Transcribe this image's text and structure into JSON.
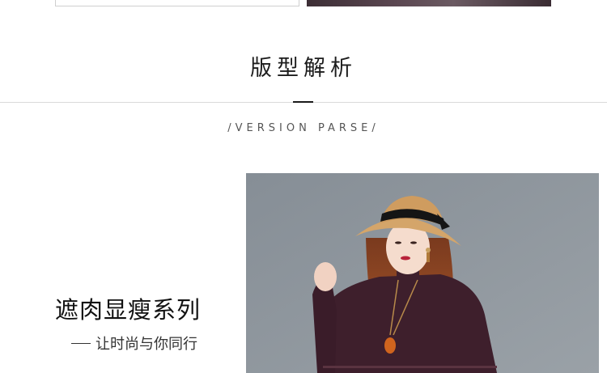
{
  "section": {
    "title": "版型解析",
    "subtitle": "/VERSION PARSE/"
  },
  "series": {
    "title": "遮肉显瘦系列",
    "tagline": "让时尚与你同行"
  },
  "photo": {
    "alt": ""
  },
  "colors": {
    "background": "#ffffff",
    "title_text": "#1d1d1d",
    "rule": "#d9d9d9",
    "accent": "#1a1a1a",
    "photo_bg": "#8e959c",
    "sweater": "#3e1f2c",
    "hat": "#d4a56a"
  }
}
